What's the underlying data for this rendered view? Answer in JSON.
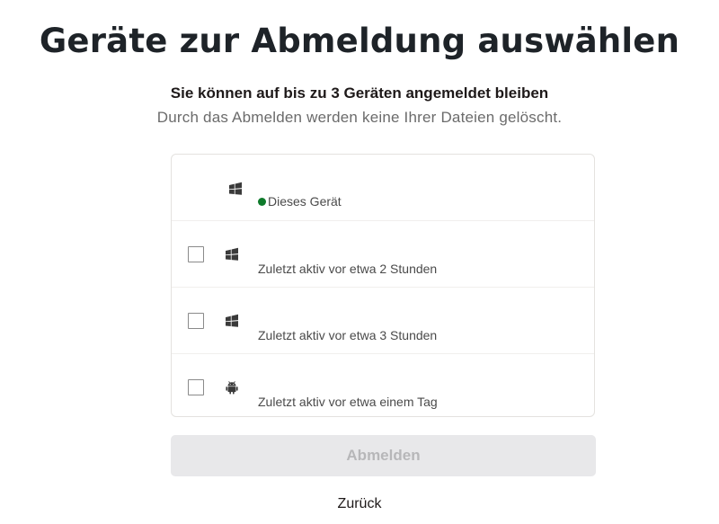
{
  "title": "Geräte zur Abmeldung auswählen",
  "subtitle": "Sie können auf bis zu 3 Geräten angemeldet bleiben",
  "description": "Durch das Abmelden werden keine Ihrer Dateien gelöscht.",
  "devices": [
    {
      "icon": "windows-icon",
      "status": "Dieses Gerät",
      "current": true,
      "checked": false
    },
    {
      "icon": "windows-icon",
      "status": "Zuletzt aktiv vor etwa 2 Stunden",
      "current": false,
      "checked": false
    },
    {
      "icon": "windows-icon",
      "status": "Zuletzt aktiv vor etwa 3 Stunden",
      "current": false,
      "checked": false
    },
    {
      "icon": "android-icon",
      "status": "Zuletzt aktiv vor etwa einem Tag",
      "current": false,
      "checked": false
    }
  ],
  "signout_button": {
    "label": "Abmelden",
    "disabled": true
  },
  "back_link": {
    "label": "Zurück"
  },
  "colors": {
    "status_dot": "#0e7a2b",
    "button_bg_disabled": "#e8e8ea",
    "button_text_disabled": "#b7b7b9"
  }
}
